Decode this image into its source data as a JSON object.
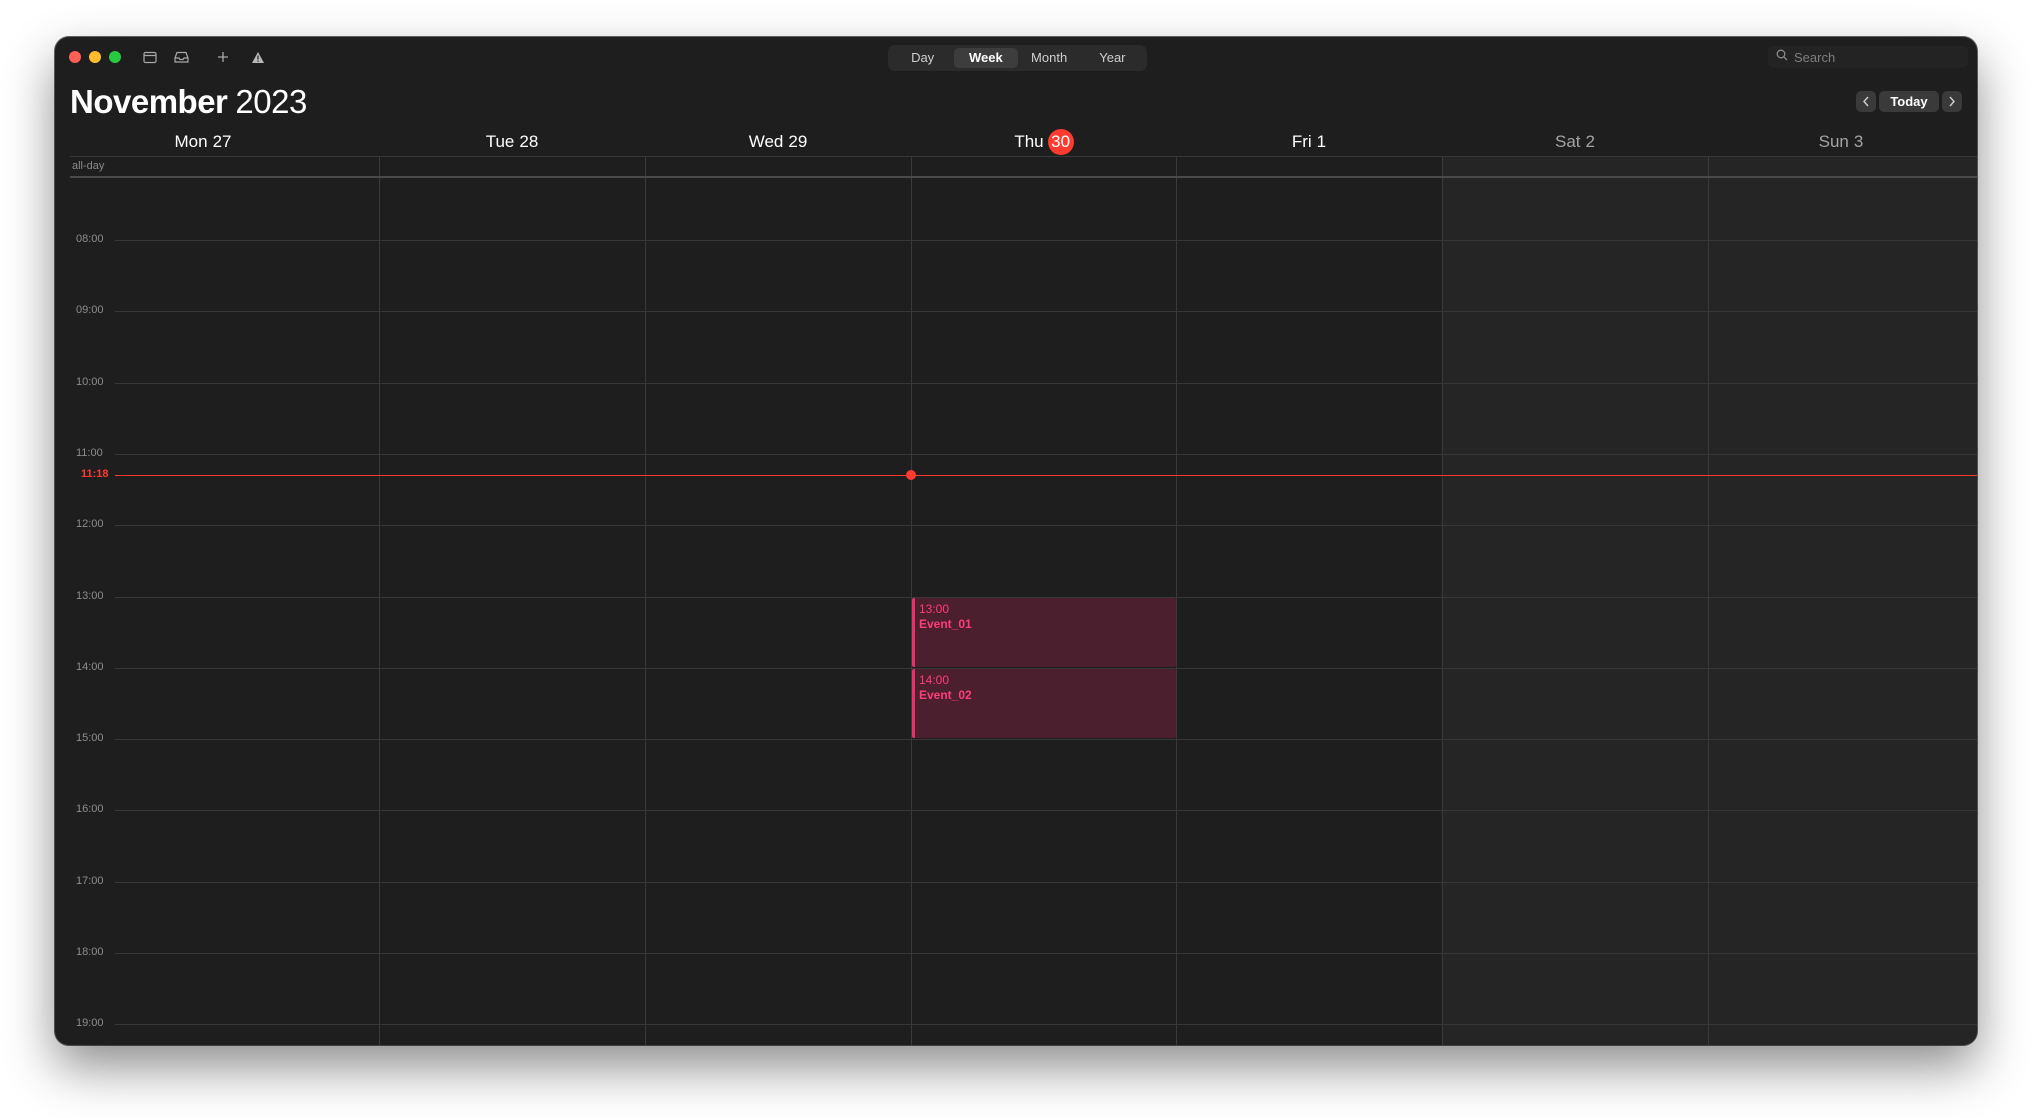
{
  "window": {
    "toolbar": {
      "icons": [
        "calendar-list-icon",
        "inbox-icon",
        "add-icon",
        "alert-icon"
      ],
      "view_tabs": [
        {
          "label": "Day",
          "active": false
        },
        {
          "label": "Week",
          "active": true
        },
        {
          "label": "Month",
          "active": false
        },
        {
          "label": "Year",
          "active": false
        }
      ],
      "search_placeholder": "Search"
    },
    "header": {
      "month": "November",
      "year": "2023",
      "today_label": "Today"
    },
    "days": [
      {
        "name": "Mon",
        "num": "27",
        "weekend": false,
        "today": false
      },
      {
        "name": "Tue",
        "num": "28",
        "weekend": false,
        "today": false
      },
      {
        "name": "Wed",
        "num": "29",
        "weekend": false,
        "today": false
      },
      {
        "name": "Thu",
        "num": "30",
        "weekend": false,
        "today": true
      },
      {
        "name": "Fri",
        "num": "1",
        "weekend": false,
        "today": false
      },
      {
        "name": "Sat",
        "num": "2",
        "weekend": true,
        "today": false
      },
      {
        "name": "Sun",
        "num": "3",
        "weekend": true,
        "today": false
      }
    ],
    "allday_label": "all-day",
    "hours": [
      "08:00",
      "09:00",
      "10:00",
      "11:00",
      "12:00",
      "13:00",
      "14:00",
      "15:00",
      "16:00",
      "17:00",
      "18:00",
      "19:00"
    ],
    "current_time": "11:18",
    "events": [
      {
        "day": 3,
        "start": "13:00",
        "end": "14:00",
        "time_label": "13:00",
        "title": "Event_01"
      },
      {
        "day": 3,
        "start": "14:00",
        "end": "15:00",
        "time_label": "14:00",
        "title": "Event_02"
      }
    ],
    "colors": {
      "today_red": "#ff3b30",
      "event_accent": "#e8306a",
      "event_fill": "#4b1f2d",
      "background": "#1e1e1e"
    }
  }
}
